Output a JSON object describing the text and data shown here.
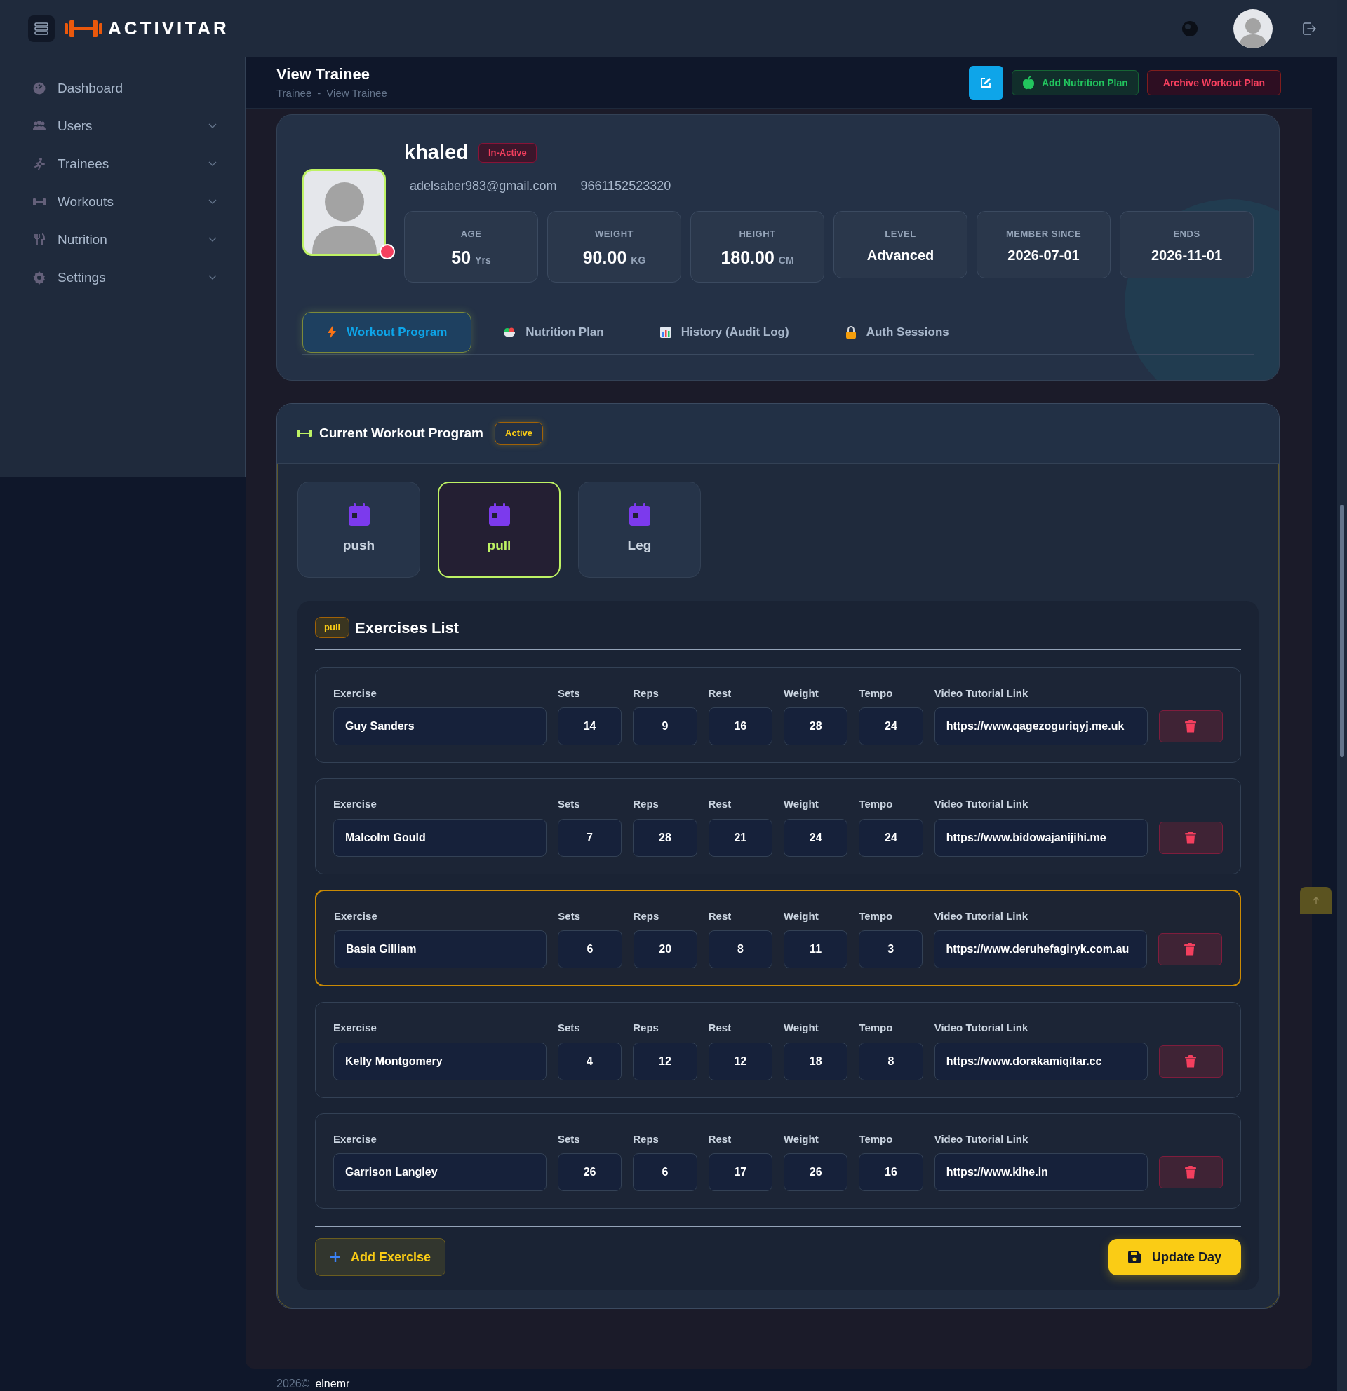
{
  "header": {
    "logo": "ACTIVITAR"
  },
  "sidebar": {
    "items": [
      {
        "label": "Dashboard",
        "has_submenu": false
      },
      {
        "label": "Users",
        "has_submenu": true
      },
      {
        "label": "Trainees",
        "has_submenu": true
      },
      {
        "label": "Workouts",
        "has_submenu": true
      },
      {
        "label": "Nutrition",
        "has_submenu": true
      },
      {
        "label": "Settings",
        "has_submenu": true
      }
    ]
  },
  "page": {
    "title": "View Trainee",
    "breadcrumb": [
      "Trainee",
      "View Trainee"
    ],
    "separator": "-",
    "actions": [
      {
        "kind": "edit"
      },
      {
        "kind": "success",
        "label": "Add Nutrition Plan"
      },
      {
        "kind": "danger",
        "label": "Archive Workout Plan"
      }
    ]
  },
  "profile": {
    "name": "khaled",
    "status": "In-Active",
    "email": "adelsaber983@gmail.com",
    "phone": "9661152523320",
    "stats": [
      {
        "label": "AGE",
        "value": "50",
        "unit": "Yrs"
      },
      {
        "label": "WEIGHT",
        "value": "90.00",
        "unit": "KG"
      },
      {
        "label": "HEIGHT",
        "value": "180.00",
        "unit": "CM"
      },
      {
        "label": "LEVEL",
        "value": "Advanced"
      },
      {
        "label": "MEMBER SINCE",
        "value": "2026-07-01"
      },
      {
        "label": "ENDS",
        "value": "2026-11-01"
      }
    ]
  },
  "tabs": [
    {
      "label": "Workout Program",
      "selected": true
    },
    {
      "label": "Nutrition Plan",
      "selected": false
    },
    {
      "label": "History (Audit Log)",
      "selected": false
    },
    {
      "label": "Auth Sessions",
      "selected": false
    }
  ],
  "program": {
    "title": "Current Workout Program",
    "status": "Active",
    "days": [
      {
        "label": "push",
        "selected": false
      },
      {
        "label": "pull",
        "selected": true
      },
      {
        "label": "Leg",
        "selected": false
      }
    ],
    "exercises": {
      "day_badge": "pull",
      "title": "Exercises List",
      "rows": [
        {
          "highlighted": false,
          "labels": [
            "Exercise",
            "Sets",
            "Reps",
            "Rest",
            "Weight",
            "Tempo",
            "Video Tutorial Link"
          ],
          "values": [
            "Guy Sanders",
            "14",
            "9",
            "16",
            "28",
            "24",
            "https://www.qagezoguriqyj.me.uk"
          ]
        },
        {
          "highlighted": false,
          "labels": [
            "Exercise",
            "Sets",
            "Reps",
            "Rest",
            "Weight",
            "Tempo",
            "Video Tutorial Link"
          ],
          "values": [
            "Malcolm Gould",
            "7",
            "28",
            "21",
            "24",
            "24",
            "https://www.bidowajanijihi.me"
          ]
        },
        {
          "highlighted": true,
          "labels": [
            "Exercise",
            "Sets",
            "Reps",
            "Rest",
            "Weight",
            "Tempo",
            "Video Tutorial Link"
          ],
          "values": [
            "Basia Gilliam",
            "6",
            "20",
            "8",
            "11",
            "3",
            "https://www.deruhefagiryk.com.au"
          ]
        },
        {
          "highlighted": false,
          "labels": [
            "Exercise",
            "Sets",
            "Reps",
            "Rest",
            "Weight",
            "Tempo",
            "Video Tutorial Link"
          ],
          "values": [
            "Kelly Montgomery",
            "4",
            "12",
            "12",
            "18",
            "8",
            "https://www.dorakamiqitar.cc"
          ]
        },
        {
          "highlighted": false,
          "labels": [
            "Exercise",
            "Sets",
            "Reps",
            "Rest",
            "Weight",
            "Tempo",
            "Video Tutorial Link"
          ],
          "values": [
            "Garrison Langley",
            "26",
            "6",
            "17",
            "26",
            "16",
            "https://www.kihe.in"
          ]
        }
      ],
      "add_button": "Add Exercise",
      "save_button": "Update Day"
    }
  },
  "footer": {
    "year": "2026©",
    "author": "elnemr"
  }
}
